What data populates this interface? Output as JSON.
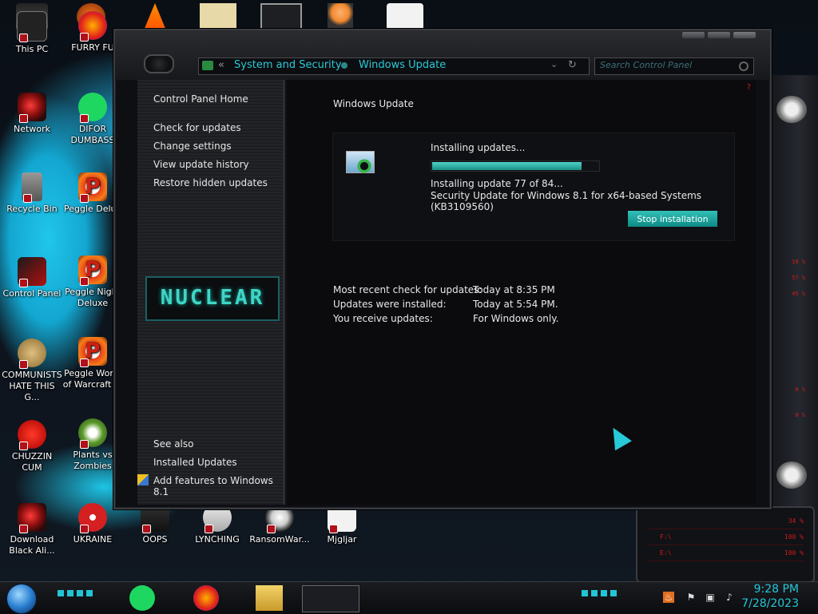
{
  "desktop": {
    "icons": [
      {
        "label": "This PC"
      },
      {
        "label": "FURRY FU"
      },
      {
        "label": "Network"
      },
      {
        "label": "DIFOR DUMBASS"
      },
      {
        "label": "Recycle Bin"
      },
      {
        "label": "Peggle Delux"
      },
      {
        "label": "Control Panel"
      },
      {
        "label": "Peggle Night Deluxe"
      },
      {
        "label": "COMMUNISTS HATE THIS G..."
      },
      {
        "label": "Peggle World of Warcraft ..."
      },
      {
        "label": "CHUZZIN CUM"
      },
      {
        "label": "Plants vs Zombies"
      },
      {
        "label": "Download Black Ali..."
      },
      {
        "label": "UKRAINE"
      },
      {
        "label": "OOPS"
      },
      {
        "label": "LYNCHING"
      },
      {
        "label": "RansomWar..."
      },
      {
        "label": "Mjgljar"
      }
    ]
  },
  "window": {
    "breadcrumb": [
      "System and Security",
      "Windows Update"
    ],
    "search_placeholder": "Search Control Panel",
    "sidebar": {
      "home": "Control Panel Home",
      "links": [
        "Check for updates",
        "Change settings",
        "View update history",
        "Restore hidden updates"
      ],
      "banner": "NUCLEAR",
      "see_also_title": "See also",
      "see_also": [
        "Installed Updates",
        "Add features to Windows 8.1"
      ]
    },
    "content": {
      "title": "Windows Update",
      "status": "Installing updates...",
      "progress_fraction": 0.9,
      "detail_count": "Installing update 77 of 84...",
      "detail_name": "Security Update for Windows 8.1 for x64-based Systems (KB3109560)",
      "stop_button": "Stop installation",
      "info": [
        {
          "label": "Most recent check for updates:",
          "value": "Today at 8:35 PM"
        },
        {
          "label": "Updates were installed:",
          "value": "Today at 5:54 PM."
        },
        {
          "label": "You receive updates:",
          "value": "For Windows only."
        }
      ]
    }
  },
  "gadget": {
    "numbers": [
      "18 %",
      "57 %",
      "45 %",
      "0 %",
      "0 %"
    ],
    "hud_rows": [
      {
        "left": "",
        "right": "34 %"
      },
      {
        "left": "F:\\",
        "right": "100 %"
      },
      {
        "left": "E:\\",
        "right": "100 %"
      }
    ]
  },
  "taskbar": {
    "time": "9:28 PM",
    "date": "7/28/2023"
  },
  "colors": {
    "accent": "#28c9d8",
    "button": "#1ca8a1",
    "alert_red": "#d11a1a"
  }
}
